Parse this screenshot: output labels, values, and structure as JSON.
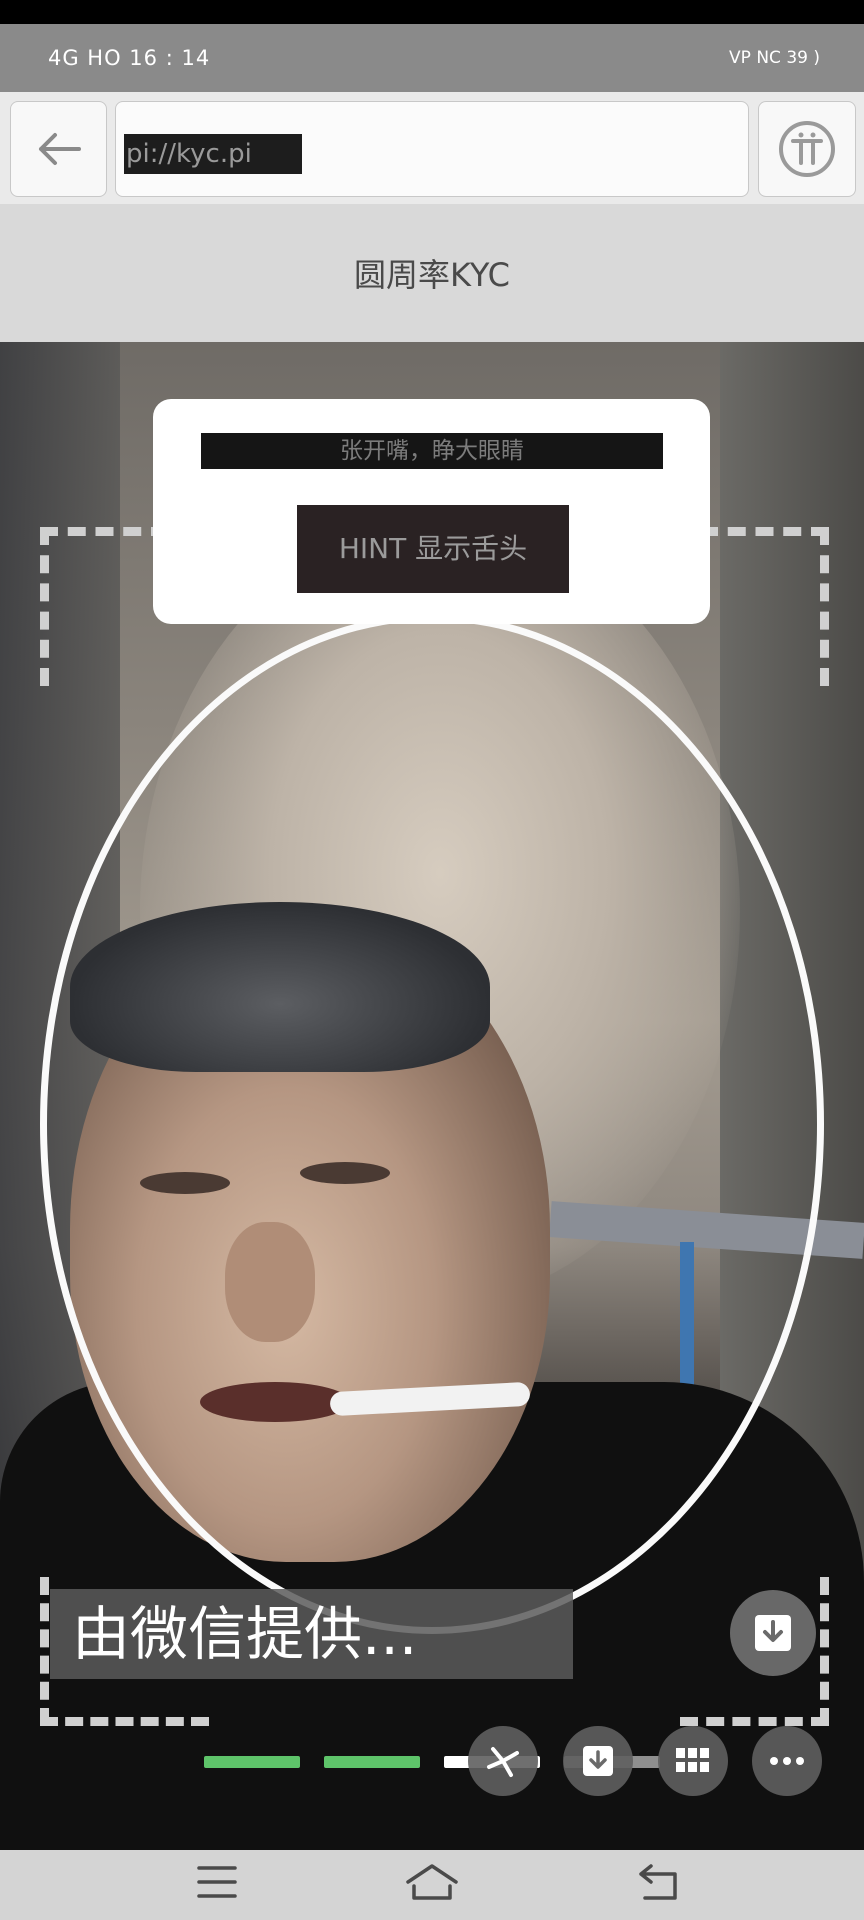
{
  "status_bar": {
    "left": "4G HO 16 : 14",
    "right": "VP NC 39 )"
  },
  "url_bar": {
    "url": "pi://kyc.pi",
    "back_icon": "arrow-left-icon",
    "pi_icon": "pi-logo-icon"
  },
  "header": {
    "title": "圆周率KYC"
  },
  "hint_card": {
    "instruction": "张开嘴，睁大眼睛",
    "hint_button": "HINT 显示舌头"
  },
  "overlay": {
    "provided_by": "由微信提供..."
  },
  "progress": {
    "segments": [
      "complete",
      "complete",
      "current",
      "pending"
    ],
    "colors": {
      "complete": "#5ec46a",
      "current": "#ffffff",
      "pending": "#8f8f8f"
    }
  },
  "toolbar": {
    "icons": [
      "pinwheel-icon",
      "download-icon",
      "grid-icon",
      "more-icon"
    ]
  },
  "nav_bar": {
    "icons": [
      "menu-icon",
      "home-icon",
      "back-icon"
    ]
  }
}
